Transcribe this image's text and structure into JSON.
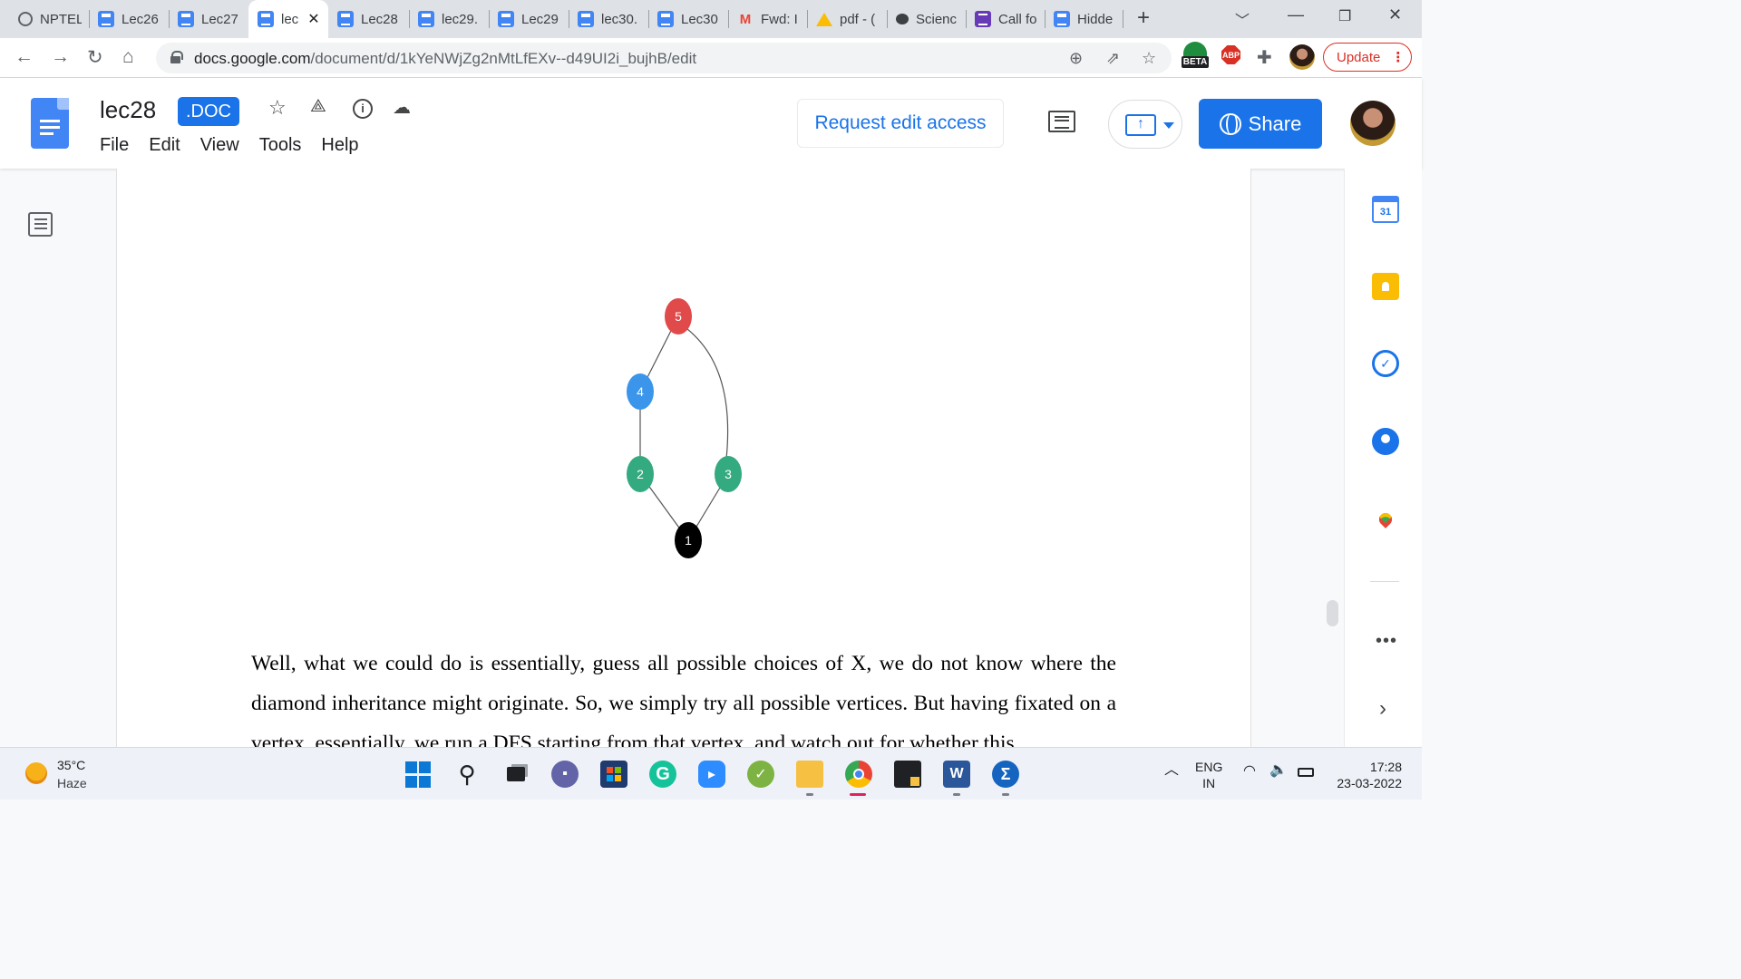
{
  "browser": {
    "tabs": [
      {
        "label": "NPTEL",
        "icon": "globe-icon"
      },
      {
        "label": "Lec26",
        "icon": "docs-icon"
      },
      {
        "label": "Lec27",
        "icon": "docs-icon"
      },
      {
        "label": "lec",
        "icon": "docs-icon",
        "active": true
      },
      {
        "label": "Lec28",
        "icon": "docs-icon"
      },
      {
        "label": "lec29.",
        "icon": "docs-icon"
      },
      {
        "label": "Lec29",
        "icon": "docs-icon"
      },
      {
        "label": "lec30.",
        "icon": "docs-icon"
      },
      {
        "label": "Lec30",
        "icon": "docs-icon"
      },
      {
        "label": "Fwd: I",
        "icon": "gmail-icon"
      },
      {
        "label": "pdf - (",
        "icon": "drive-icon"
      },
      {
        "label": "Scienc",
        "icon": "chat-bubble-icon"
      },
      {
        "label": "Call fo",
        "icon": "forms-icon"
      },
      {
        "label": "Hidde",
        "icon": "docs-icon"
      }
    ],
    "address": {
      "host": "docs.google.com",
      "path": "/document/d/1kYeNWjZg2nMtLfEXv--d49UI2i_bujhB/edit"
    },
    "extensions": {
      "beta_label": "BETA",
      "abp_label": "ABP"
    },
    "update_label": "Update"
  },
  "docs": {
    "title": "lec28",
    "badge": ".DOC",
    "menu": [
      "File",
      "Edit",
      "View",
      "Tools",
      "Help"
    ],
    "request_edit_label": "Request edit access",
    "share_label": "Share",
    "present_arrow": "↑"
  },
  "graph": {
    "nodes": [
      {
        "id": "5",
        "label": "5",
        "color": "#e04a4a"
      },
      {
        "id": "4",
        "label": "4",
        "color": "#3b95ea"
      },
      {
        "id": "2",
        "label": "2",
        "color": "#33aa7f"
      },
      {
        "id": "3",
        "label": "3",
        "color": "#33aa7f"
      },
      {
        "id": "1",
        "label": "1",
        "color": "#000000"
      }
    ],
    "edges": [
      [
        "5",
        "4"
      ],
      [
        "5",
        "3"
      ],
      [
        "4",
        "2"
      ],
      [
        "2",
        "1"
      ],
      [
        "3",
        "1"
      ]
    ]
  },
  "document": {
    "paragraph": "Well, what we could do is essentially, guess all possible choices of X, we do not know where the diamond inheritance might originate. So, we simply try all possible vertices. But having fixated on a vertex, essentially, we run a DFS starting from that vertex, and watch out for whether this"
  },
  "side_panel": {
    "calendar_day": "31",
    "more_label": "•••",
    "expand_label": "›"
  },
  "taskbar": {
    "weather_temp": "35°C",
    "weather_desc": "Haze",
    "lang_line1": "ENG",
    "lang_line2": "IN",
    "time": "17:28",
    "date": "23-03-2022",
    "word_label": "W"
  }
}
